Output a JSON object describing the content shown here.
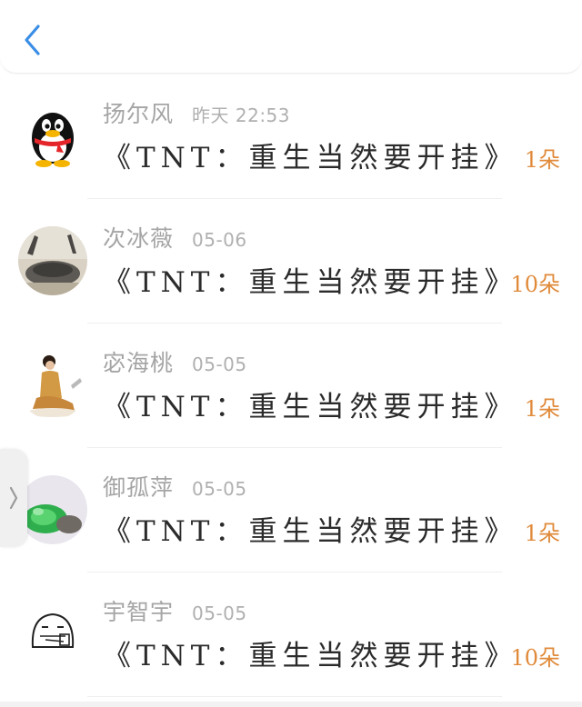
{
  "header": {
    "back_icon": "chevron-left-icon",
    "accent_color": "#3a8ee6"
  },
  "gifts": [
    {
      "name": "扬尔风",
      "time": "昨天 22:53",
      "gift": "《TNT：重生当然要开挂》",
      "count": "1朵",
      "avatar": "qq-penguin-avatar"
    },
    {
      "name": "次冰薇",
      "time": "05-06",
      "gift": "《TNT：重生当然要开挂》",
      "count": "10朵",
      "avatar": "photo-avatar"
    },
    {
      "name": "宓海桃",
      "time": "05-05",
      "gift": "《TNT：重生当然要开挂》",
      "count": "1朵",
      "avatar": "portrait-avatar"
    },
    {
      "name": "御孤萍",
      "time": "05-05",
      "gift": "《TNT：重生当然要开挂》",
      "count": "1朵",
      "avatar": "jade-avatar"
    },
    {
      "name": "宇智宇",
      "time": "05-05",
      "gift": "《TNT：重生当然要开挂》",
      "count": "10朵",
      "avatar": "sketch-avatar"
    }
  ],
  "side_handle_icon": "chevron-right-icon",
  "colors": {
    "count": "#e08a3a",
    "name": "#a5a5a5",
    "title": "#2b2b2b"
  }
}
